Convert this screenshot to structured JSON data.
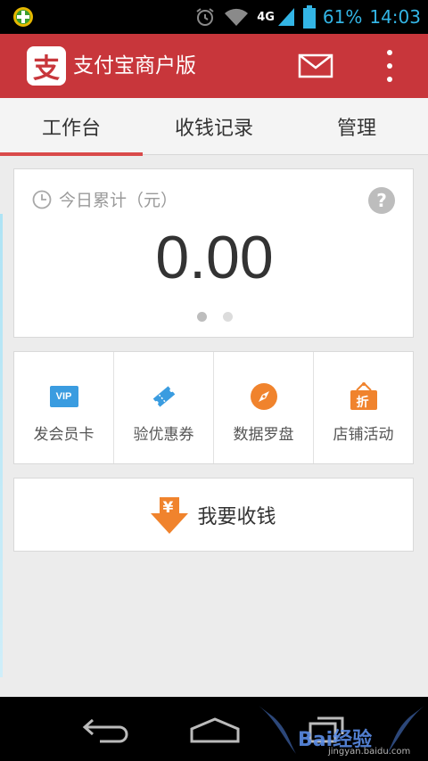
{
  "status_bar": {
    "network": "4G",
    "battery": "61%",
    "time": "14:03"
  },
  "app_bar": {
    "logo_char": "支",
    "title": "支付宝商户版"
  },
  "tabs": [
    {
      "label": "工作台",
      "active": true
    },
    {
      "label": "收钱记录",
      "active": false
    },
    {
      "label": "管理",
      "active": false
    }
  ],
  "today": {
    "label": "今日累计（元）",
    "help": "?",
    "amount": "0.00",
    "pages": 2,
    "current_page": 1
  },
  "features": [
    {
      "label": "发会员卡",
      "icon": "vip-card-icon",
      "icon_text": "VIP",
      "color": "#3a9ce0"
    },
    {
      "label": "验优惠券",
      "icon": "coupon-icon",
      "color": "#3a9ce0"
    },
    {
      "label": "数据罗盘",
      "icon": "compass-icon",
      "color": "#f0832d"
    },
    {
      "label": "店铺活动",
      "icon": "discount-tag-icon",
      "icon_text": "折",
      "color": "#f0832d"
    }
  ],
  "collect": {
    "label": "我要收钱",
    "icon_text": "¥",
    "color": "#f0832d"
  },
  "watermark": {
    "text": "Bai经验",
    "url_text": "jingyan.baidu.com"
  },
  "colors": {
    "app_bar": "#c8363b",
    "tab_indicator": "#d94a4a",
    "status_icons": "#33b5e5"
  }
}
